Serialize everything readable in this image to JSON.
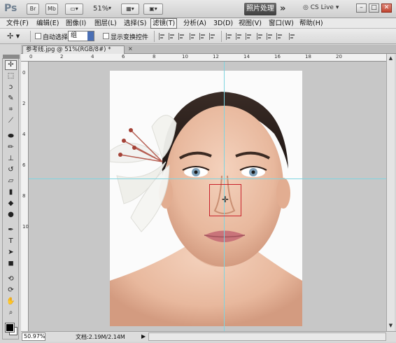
{
  "appbar": {
    "logo": "Ps",
    "br_label": "Br",
    "mb_label": "Mb",
    "zoom": "51%",
    "workspace": "照片处理",
    "more": "»",
    "cs_live": "CS Live",
    "window_controls": [
      "–",
      "□",
      "✕"
    ]
  },
  "menu": {
    "items": [
      "文件(F)",
      "编辑(E)",
      "图像(I)",
      "图层(L)",
      "选择(S)",
      "滤镜(T)",
      "分析(A)",
      "3D(D)",
      "视图(V)",
      "窗口(W)",
      "帮助(H)"
    ],
    "active_index": 5
  },
  "options": {
    "auto_select_label": "自动选择:",
    "auto_select_value": "组",
    "show_transform_label": "显示变换控件"
  },
  "document": {
    "tab_title": "参考线.jpg @ 51%(RGB/8#) *",
    "close_glyph": "×",
    "rulers_h": [
      "0",
      "2",
      "4",
      "6",
      "8",
      "10",
      "12",
      "14",
      "16",
      "18",
      "20"
    ],
    "rulers_v": [
      "0",
      "2",
      "4",
      "6",
      "8",
      "10"
    ]
  },
  "status": {
    "zoom": "50.97%",
    "doc_info": "文档:2.19M/2.14M"
  },
  "tools": [
    "move",
    "marquee",
    "lasso",
    "quick-select",
    "crop",
    "eyedropper",
    "healing",
    "brush",
    "clone-stamp",
    "history-brush",
    "eraser",
    "gradient",
    "blur",
    "dodge",
    "pen",
    "type",
    "path-select",
    "shape",
    "3d-rotate",
    "3d-orbit",
    "hand",
    "zoom"
  ],
  "colors": {
    "guide": "#7fd4e0",
    "selection": "#c8202a",
    "workspace_bg": "#c7c7c7"
  }
}
